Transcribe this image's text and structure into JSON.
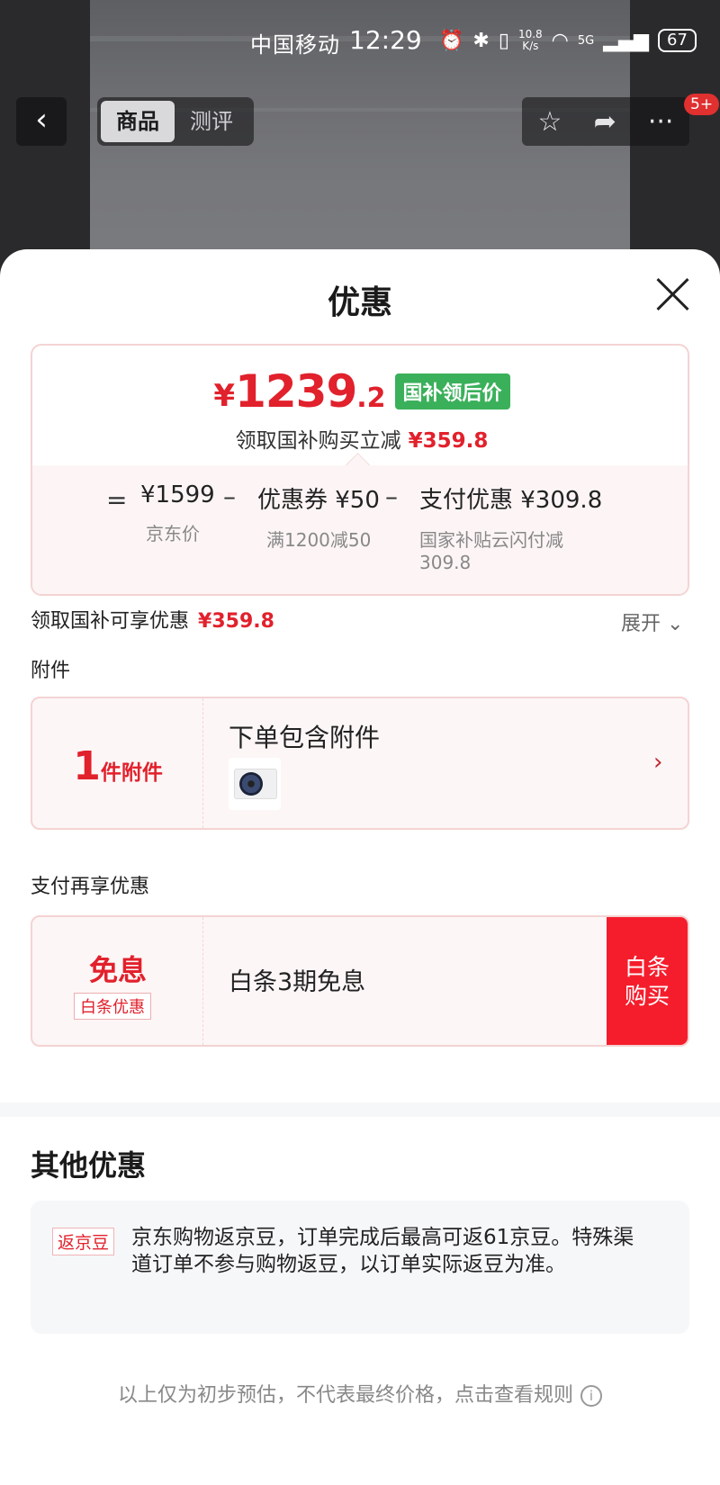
{
  "status_bar": {
    "carrier": "中国移动",
    "time": "12:29",
    "net_speed_value": "10.8",
    "net_speed_unit": "K/s",
    "network": "5G",
    "battery": "67",
    "icons": [
      "alarm-icon",
      "bluetooth-icon",
      "vibrate-icon",
      "wifi-icon",
      "signal-icon"
    ]
  },
  "nav": {
    "back_icon": "chevron-left-icon",
    "tabs": [
      {
        "label": "商品",
        "active": true
      },
      {
        "label": "测评",
        "active": false
      }
    ],
    "actions": [
      "star-icon",
      "share-icon",
      "more-icon"
    ],
    "more_badge": "5+"
  },
  "sheet": {
    "title": "优惠",
    "close_icon": "close-icon"
  },
  "price_card": {
    "currency": "¥",
    "price_integer": "1239",
    "price_decimal": ".2",
    "price_tag": "国补领后价",
    "subtitle": "领取国补购买立减",
    "subtitle_amount": "¥359.8",
    "breakdown": {
      "eq": "=",
      "minus": "–",
      "items": [
        {
          "amount": "¥1599",
          "label": "京东价"
        },
        {
          "amount": "优惠券 ¥50",
          "label": "满1200减50"
        },
        {
          "amount": "支付优惠 ¥309.8",
          "label_line1": "国家补贴云闪付减",
          "label_line2": "309.8"
        }
      ]
    }
  },
  "savings": {
    "label": "领取国补可享优惠",
    "amount": "¥359.8",
    "expand": "展开",
    "expand_icon": "chevron-down-icon"
  },
  "accessories": {
    "section_title": "附件",
    "count": "1",
    "count_unit": "件附件",
    "title": "下单包含附件",
    "thumb": "air-conditioner-outdoor-unit",
    "chevron": "›"
  },
  "payment": {
    "section_title": "支付再享优惠",
    "main": "免息",
    "sub": "白条优惠",
    "title": "白条3期免息",
    "buy_line1": "白条",
    "buy_line2": "购买"
  },
  "other": {
    "title": "其他优惠",
    "tag": "返京豆",
    "text": "京东购物返京豆，订单完成后最高可返61京豆。特殊渠道订单不参与购物返豆，以订单实际返豆为准。"
  },
  "footer": {
    "note": "以上仅为初步预估，不代表最终价格，点击查看规则",
    "info_icon": "i"
  },
  "colors": {
    "accent_red": "#e1212c",
    "tag_green": "#3bb05a",
    "buy_red": "#f51d2c"
  }
}
